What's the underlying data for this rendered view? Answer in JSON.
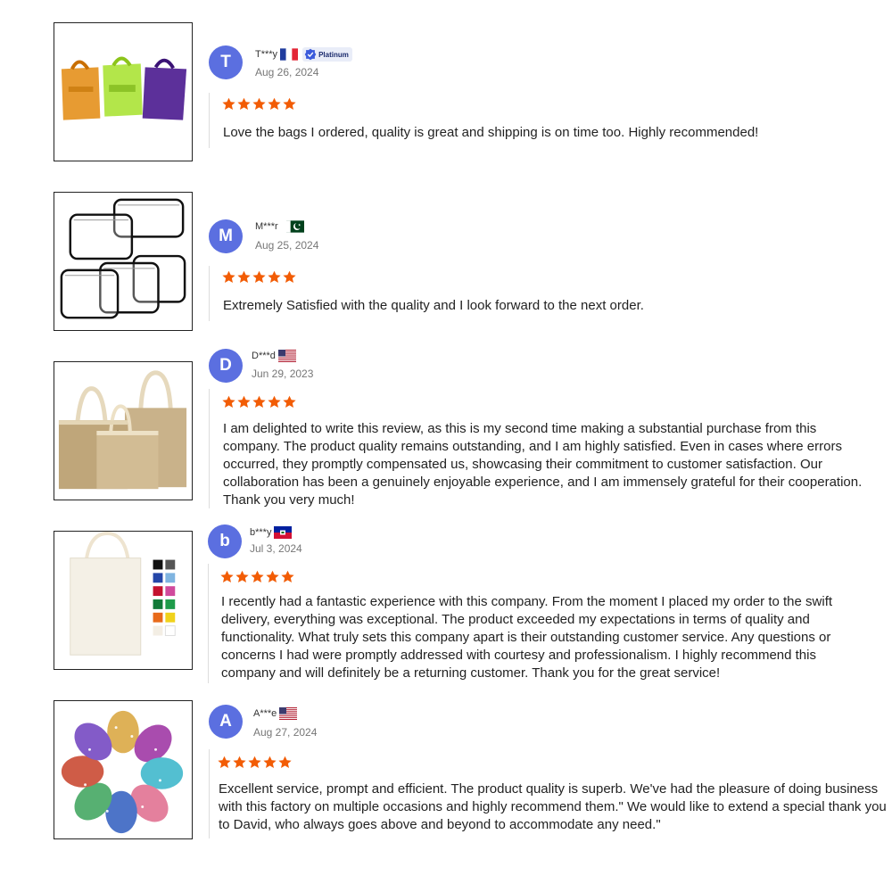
{
  "colors": {
    "avatar": "#5b6fe0",
    "star": "#f25c05",
    "divider": "#dddddd"
  },
  "reviews": [
    {
      "initial": "T",
      "name": "T***y",
      "flag": "France",
      "badge": "Platinum",
      "date": "Aug 26, 2024",
      "rating": 5,
      "image": "clear-colored-plastic-bags",
      "text": "Love the bags I ordered, quality is great and shipping is on time too. Highly recommended!"
    },
    {
      "initial": "M",
      "name": "M***r",
      "flag": "Pakistan",
      "date": "Aug 25, 2024",
      "rating": 5,
      "image": "clear-pvc-zipper-pouches",
      "text": "Extremely Satisfied with the quality and I look forward to the next order."
    },
    {
      "initial": "D",
      "name": "D***d",
      "flag": "United States",
      "date": "Jun 29, 2023",
      "rating": 5,
      "image": "jute-tote-bags",
      "text": "I am delighted to write this review, as this is my second time making a substantial purchase from this company. The product quality remains outstanding, and I am highly satisfied. Even in cases where errors occurred, they promptly compensated us, showcasing their commitment to customer satisfaction. Our collaboration has been a genuinely enjoyable experience, and I am immensely grateful for their cooperation. Thank you very much!"
    },
    {
      "initial": "b",
      "name": "b***y",
      "flag": "Haiti",
      "date": "Jul 3, 2024",
      "rating": 5,
      "image": "canvas-tote-bag-color-swatches",
      "text": "I recently had a fantastic experience with this company. From the moment I placed my order to the swift delivery, everything was exceptional. The product exceeded my expectations in terms of quality and functionality. What truly sets this company apart is their outstanding customer service. Any questions or concerns I had were promptly addressed with courtesy and professionalism. I highly recommend this company and will definitely be a returning customer. Thank you for the great service!"
    },
    {
      "initial": "A",
      "name": "A***e",
      "flag": "United States",
      "date": "Aug 27, 2024",
      "rating": 5,
      "image": "organza-drawstring-pouches",
      "text": "Excellent service, prompt and efficient. The product quality is superb. We've had the pleasure of doing business with this factory on multiple occasions and highly recommend them.\" We would like to extend a special thank you to David, who always goes above and beyond to accommodate any need.\""
    }
  ]
}
